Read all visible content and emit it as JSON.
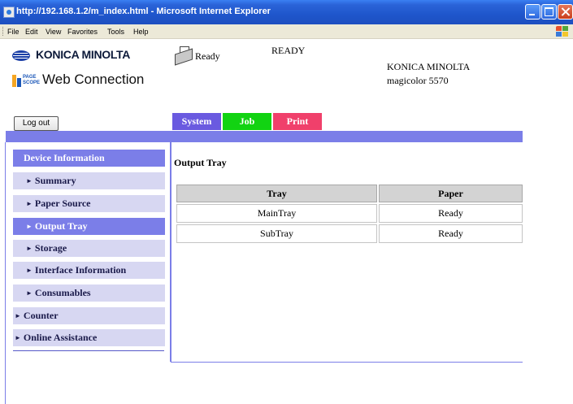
{
  "window": {
    "title": "http://192.168.1.2/m_index.html - Microsoft Internet Explorer"
  },
  "menu": [
    "File",
    "Edit",
    "View",
    "Favorites",
    "Tools",
    "Help"
  ],
  "header": {
    "brand_logo_text": "KONICA MINOLTA",
    "pagescope_small_1": "PAGE",
    "pagescope_small_2": "SCOPE",
    "product_name": "Web Connection",
    "status_icon_label": "Ready",
    "status_text": "READY",
    "device_brand": "KONICA MINOLTA",
    "device_model": "magicolor 5570"
  },
  "logout_label": "Log out",
  "tabs": {
    "system": "System",
    "job": "Job",
    "print": "Print"
  },
  "sidebar": {
    "section": "Device Information",
    "items": [
      "Summary",
      "Paper Source",
      "Output Tray",
      "Storage",
      "Interface Information",
      "Consumables"
    ],
    "active_index": 2,
    "top_items": [
      "Counter",
      "Online Assistance"
    ]
  },
  "main": {
    "title": "Output Tray",
    "table": {
      "headers": [
        "Tray",
        "Paper"
      ],
      "rows": [
        [
          "MainTray",
          "Ready"
        ],
        [
          "SubTray",
          "Ready"
        ]
      ]
    }
  },
  "colors": {
    "accent": "#7b7ee8",
    "sidebar_bg": "#d7d7f2",
    "tab_system": "#6a5ae0",
    "tab_job": "#12d312",
    "tab_print": "#f0406b"
  }
}
